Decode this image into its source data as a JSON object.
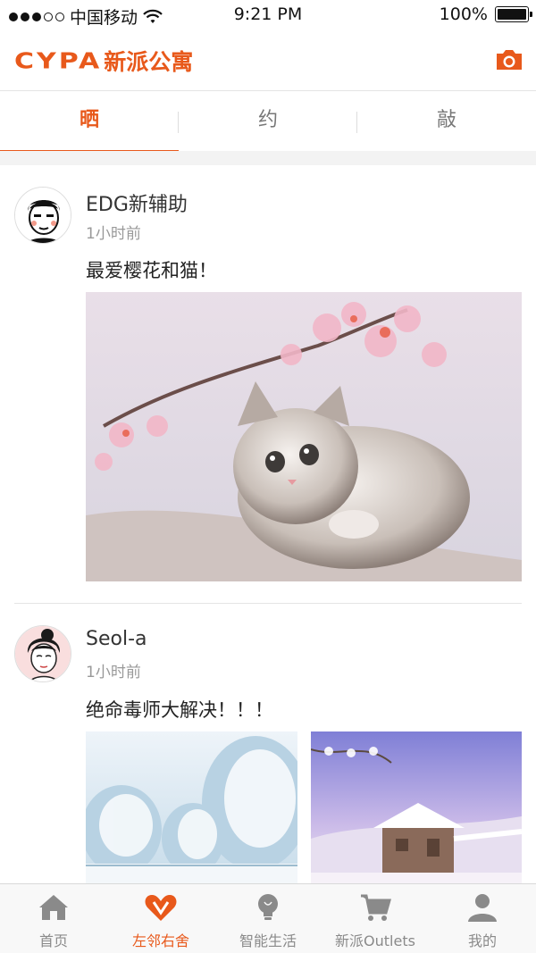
{
  "status_bar": {
    "carrier": "中国移动",
    "time": "9:21 PM",
    "battery": "100%",
    "battery_level": 1.0,
    "signal_strength": 3
  },
  "header": {
    "logo_latin": "CYPA",
    "logo_cn": "新派公寓",
    "camera_icon": "camera-icon",
    "brand_color": "#e8591b"
  },
  "tabs": [
    {
      "label": "晒",
      "active": true
    },
    {
      "label": "约",
      "active": false
    },
    {
      "label": "敲",
      "active": false
    }
  ],
  "posts": [
    {
      "author": "EDG新辅助",
      "time": "1小时前",
      "text": "最爱樱花和猫！",
      "avatar_icon": "cartoon-man-avatar",
      "images": [
        "kitten-cherry-blossom"
      ]
    },
    {
      "author": "Seol-a",
      "time": "1小时前",
      "text": "绝命毒师大解决！！！",
      "avatar_icon": "cartoon-woman-avatar",
      "images": [
        "snowy-trees",
        "snowy-cabin"
      ]
    }
  ],
  "tabbar": [
    {
      "label": "首页",
      "icon": "home-icon",
      "active": false
    },
    {
      "label": "左邻右舍",
      "icon": "neighbors-heart-icon",
      "active": true
    },
    {
      "label": "智能生活",
      "icon": "lightbulb-icon",
      "active": false
    },
    {
      "label": "新派Outlets",
      "icon": "cart-icon",
      "active": false
    },
    {
      "label": "我的",
      "icon": "user-icon",
      "active": false
    }
  ]
}
